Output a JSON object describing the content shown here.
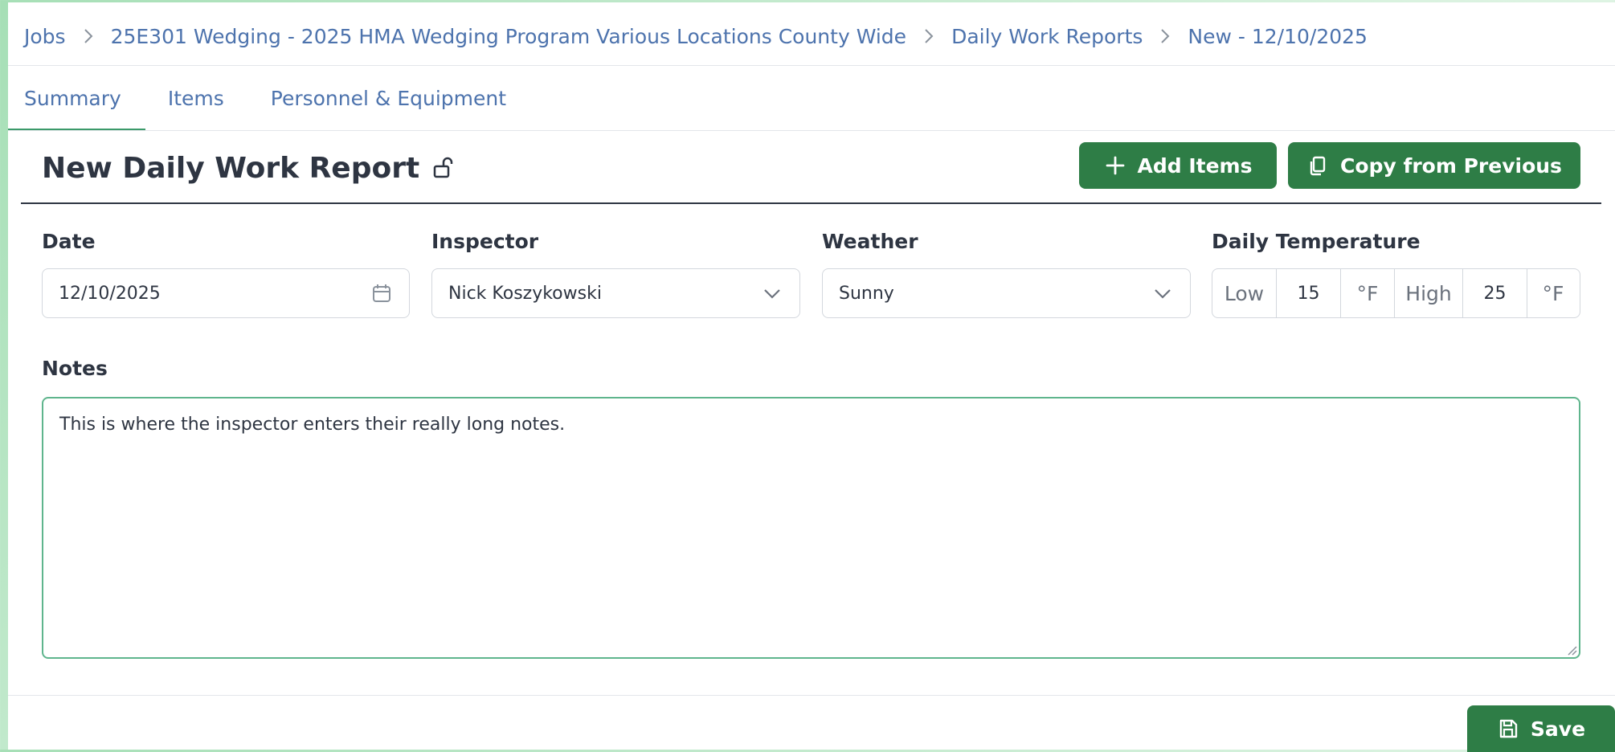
{
  "breadcrumb": {
    "items": [
      "Jobs",
      "25E301 Wedging - 2025 HMA Wedging Program Various Locations County Wide",
      "Daily Work Reports",
      "New - 12/10/2025"
    ]
  },
  "tabs": [
    {
      "label": "Summary",
      "active": true
    },
    {
      "label": "Items",
      "active": false
    },
    {
      "label": "Personnel & Equipment",
      "active": false
    }
  ],
  "header": {
    "title": "New Daily Work Report",
    "lock_icon": "unlock-icon",
    "add_items_label": "Add Items",
    "copy_label": "Copy from Previous"
  },
  "form": {
    "date": {
      "label": "Date",
      "value": "12/10/2025",
      "icon": "calendar-icon"
    },
    "inspector": {
      "label": "Inspector",
      "value": "Nick Koszykowski"
    },
    "weather": {
      "label": "Weather",
      "value": "Sunny"
    },
    "temperature": {
      "label": "Daily Temperature",
      "low_label": "Low",
      "low_value": "15",
      "low_unit": "°F",
      "high_label": "High",
      "high_value": "25",
      "high_unit": "°F"
    },
    "notes": {
      "label": "Notes",
      "value": "This is where the inspector enters their really long notes."
    }
  },
  "footer": {
    "save_label": "Save"
  },
  "colors": {
    "accent": "#2e7d46",
    "link": "#4d73ad",
    "focus": "#5fb58d"
  }
}
